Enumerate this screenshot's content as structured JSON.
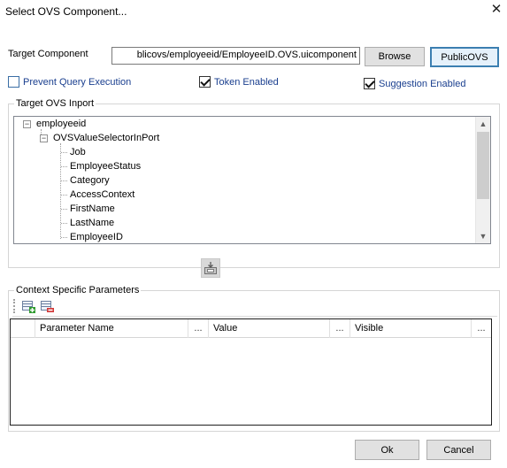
{
  "window": {
    "title": "Select OVS Component..."
  },
  "target": {
    "label": "Target Component",
    "value": "blicovs/employeeid/EmployeeID.OVS.uicomponent",
    "browse_label": "Browse",
    "public_ovs_label": "PublicOVS"
  },
  "options": {
    "prevent_query": {
      "label": "Prevent Query Execution",
      "checked": false
    },
    "token_enabled": {
      "label": "Token Enabled",
      "checked": true
    },
    "suggestion_enabled": {
      "label": "Suggestion Enabled",
      "checked": true
    }
  },
  "target_inport": {
    "legend": "Target OVS Inport",
    "tree": {
      "root": "employeeid",
      "child": "OVSValueSelectorInPort",
      "leaves": [
        "Job",
        "EmployeeStatus",
        "Category",
        "AccessContext",
        "FirstName",
        "LastName",
        "EmployeeID"
      ]
    }
  },
  "context_params": {
    "legend": "Context Specific Parameters",
    "toolbar": {
      "add_icon": "add-row-icon",
      "remove_icon": "remove-row-icon"
    },
    "columns": [
      "Parameter Name",
      "Value",
      "Visible"
    ],
    "more_glyph": "...",
    "rows": []
  },
  "footer": {
    "ok_label": "Ok",
    "cancel_label": "Cancel"
  },
  "colors": {
    "accent": "#3c7fb1",
    "link": "#1a3f8f",
    "scroll_thumb": "#cdcdcd"
  }
}
